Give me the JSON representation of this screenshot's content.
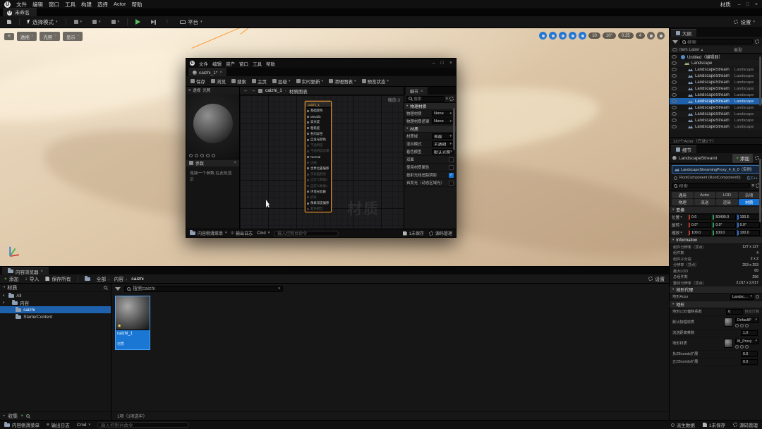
{
  "colors": {
    "selection_blue": "#1673d6",
    "accent_orange": "#e8963c",
    "play_green": "#57c05a"
  },
  "glyphs": {
    "minimize": "–",
    "maximize": "□",
    "close": "×"
  },
  "titlebar": {
    "menus": [
      "文件",
      "编辑",
      "窗口",
      "工具",
      "构建",
      "选择",
      "Actor",
      "帮助"
    ],
    "window_label": "材质"
  },
  "project_tab": {
    "label": "未命名"
  },
  "main_toolbar": {
    "mode_label": "选择模式",
    "platform_label": "平台",
    "settings_label": "设置"
  },
  "viewport": {
    "nav": {
      "perspective": "透视",
      "lit": "光照",
      "show": "显示"
    },
    "icons_left": [
      {
        "active": true
      },
      {
        "active": true
      },
      {
        "active": true
      },
      {
        "active": true
      },
      {
        "active": true
      }
    ],
    "badges": [
      "10",
      "10°",
      "0.25",
      "4"
    ],
    "icons_right": [
      {
        "active": false
      },
      {
        "active": false
      }
    ]
  },
  "material_editor": {
    "menus": [
      "文件",
      "编辑",
      "资产",
      "窗口",
      "工具",
      "帮助"
    ],
    "tab_label": "caizhi_1*",
    "toolbar": [
      {
        "label": "保存"
      },
      {
        "label": "浏览"
      },
      {
        "label": "搜索"
      },
      {
        "label": "主页"
      },
      {
        "label": "层级",
        "arrow": true
      },
      {
        "label": "实时更新",
        "arrow": true
      },
      {
        "label": "清理图表",
        "arrow": true
      },
      {
        "label": "预览状态",
        "arrow": true
      }
    ],
    "preview_nav": {
      "perspective": "透视",
      "lit": "光照"
    },
    "params": {
      "title": "参数",
      "empty_text": "连接一个参数,在此处显示"
    },
    "graph": {
      "asset": "caizhi_1",
      "page": "材质图表",
      "zoom": "缩放-3",
      "watermark": "材质"
    },
    "node": {
      "title": "caizhi_1",
      "pins": [
        {
          "label": "基础颜色"
        },
        {
          "label": "Metallic"
        },
        {
          "label": "高光度"
        },
        {
          "label": "粗糙度"
        },
        {
          "label": "各向异性"
        },
        {
          "label": "自发光颜色"
        },
        {
          "label": "不透明度",
          "dim": true
        },
        {
          "label": "不透明度遮罩",
          "dim": true
        },
        {
          "label": "Normal"
        },
        {
          "label": "切线",
          "dim": true
        },
        {
          "label": "世界位置偏移"
        },
        {
          "label": "次表面颜色",
          "dim": true
        },
        {
          "label": "自定义数据0",
          "dim": true
        },
        {
          "label": "自定义数据1",
          "dim": true
        },
        {
          "label": "环境光遮蔽"
        },
        {
          "label": "折射",
          "dim": true
        },
        {
          "label": "像素深度偏移"
        },
        {
          "label": "着色模型",
          "dim": true
        }
      ]
    },
    "details": {
      "tab": "细节",
      "search_placeholder": "搜索",
      "section_phys_title": "物理材质",
      "phys_rows": [
        {
          "label": "物理材质",
          "value": "None"
        },
        {
          "label": "物理材质遮罩",
          "value": "None"
        }
      ],
      "section_mat_title": "材质",
      "mat_rows": [
        {
          "label": "材质域",
          "value": "表面"
        },
        {
          "label": "混合模式",
          "value": "不透明"
        },
        {
          "label": "着色模型",
          "value": "默认光照"
        },
        {
          "label": "双面",
          "is_checkbox": true,
          "checked": false
        },
        {
          "label": "使用材质属性",
          "is_checkbox": true,
          "checked": false
        },
        {
          "label": "投射光线追踪阴影",
          "is_checkbox": true,
          "checked": true
        },
        {
          "label": "自发光（动态区域光）",
          "is_checkbox": true,
          "checked": false
        }
      ]
    },
    "statusbar": {
      "content_drawer": "内容侧滑菜单",
      "output_log": "输出日志",
      "cmd": "Cmd",
      "console_placeholder": "输入控制台命令",
      "unsaved": "1未保存",
      "source_control": "源码管理"
    }
  },
  "outliner": {
    "tab": "大纲",
    "search_placeholder": "搜索",
    "header": {
      "item_label": "Item Label",
      "type_label": "类型"
    },
    "rows": [
      {
        "label": "Untitled（编辑器）",
        "type": "",
        "world": true
      },
      {
        "label": "Landscape",
        "type": "",
        "parent": true,
        "d1": true
      },
      {
        "label": "LandscapeStream",
        "type": "Landscape",
        "d2": true
      },
      {
        "label": "LandscapeStream",
        "type": "Landscape",
        "d2": true
      },
      {
        "label": "LandscapeStream",
        "type": "Landscape",
        "d2": true
      },
      {
        "label": "LandscapeStream",
        "type": "Landscape",
        "d2": true
      },
      {
        "label": "LandscapeStream",
        "type": "Landscape",
        "d2": true
      },
      {
        "label": "LandscapeStream",
        "type": "Landscape",
        "d2": true,
        "selected": true
      },
      {
        "label": "LandscapeStream",
        "type": "Landscape",
        "d2": true
      },
      {
        "label": "LandscapeStream",
        "type": "Landscape",
        "d2": true
      },
      {
        "label": "LandscapeStream",
        "type": "Landscape",
        "d2": true
      },
      {
        "label": "LandscapeStream",
        "type": "Landscape",
        "d2": true
      }
    ],
    "footer": "137个Actor（已选1个）"
  },
  "details_panel": {
    "tab": "细节",
    "component_name": "LandscapeStreami",
    "add_label": "添加",
    "instance_label": "LandscapeStreamingProxy_4_6_0（实例）",
    "root_label": "RootComponent (RootComponent0)",
    "cpp_label": "在C++",
    "search_placeholder": "搜索",
    "chips": [
      {
        "label": "通用"
      },
      {
        "label": "Actor"
      },
      {
        "label": "LOD"
      },
      {
        "label": "杂项"
      },
      {
        "label": "物理"
      },
      {
        "label": "流送"
      },
      {
        "label": "渲染"
      },
      {
        "label": "材质",
        "active": true
      }
    ],
    "transform": {
      "title": "变换",
      "rows": [
        {
          "label": "位置",
          "x": "0.0",
          "y": "50400.0",
          "z": "100.0"
        },
        {
          "label": "旋转",
          "x": "0.0°",
          "y": "0.0°",
          "z": "0.0°"
        },
        {
          "label": "缩放",
          "x": "100.0",
          "y": "100.0",
          "z": "100.0"
        }
      ]
    },
    "information": {
      "title": "Information",
      "rows": [
        {
          "label": "组件分辨率（顶点）",
          "value": "127 x 127"
        },
        {
          "label": "组件数",
          "value": "4"
        },
        {
          "label": "组件子分段",
          "value": "2 x 2"
        },
        {
          "label": "分辨率（顶点）",
          "value": "253 x 253"
        },
        {
          "label": "最大LOD",
          "value": "65"
        },
        {
          "label": "总组件数",
          "value": "256"
        },
        {
          "label": "整体分辨率（顶点）",
          "value": "2,017 x 2,017"
        }
      ]
    },
    "proxy": {
      "title": "地形代理",
      "row_label": "地形Actor",
      "row_value": "Landsc…"
    },
    "landscape": {
      "title": "地形",
      "rows_a": [
        {
          "label": "地形LOD偏移系数",
          "value": "0",
          "note": "自动计算"
        }
      ],
      "phys_label": "默认物理材质",
      "phys_value": "DefaultP",
      "rows_b": [
        {
          "label": "流送距离乘数",
          "value": "1.0",
          "note": ""
        }
      ],
      "mat_label": "地形材质",
      "mat_value": "M_Proxy",
      "rows_c": [
        {
          "label": "负ZBounds扩展",
          "value": "0.0",
          "note": ""
        },
        {
          "label": "正ZBounds扩展",
          "value": "0.0",
          "note": ""
        }
      ]
    }
  },
  "content_browser": {
    "tab": "内容浏览器",
    "add_label": "添加",
    "import_label": "导入",
    "save_all_label": "保存所有",
    "breadcrumb": [
      "全部",
      "内容",
      "caizhi"
    ],
    "settings_label": "设置",
    "favorites_label": "材质",
    "tree": [
      {
        "label": "All",
        "expanded": true
      },
      {
        "label": "内容",
        "expanded": true,
        "d1": true
      },
      {
        "label": "caizhi",
        "d2": true,
        "selected": true
      },
      {
        "label": "StarterContent",
        "d2": true
      }
    ],
    "collections_label": "收集",
    "search_value": "搜索caizhi",
    "asset": {
      "name": "caizhi_1",
      "type": "材质"
    },
    "status": "1项（1项选中）"
  },
  "status_bar": {
    "content_drawer": "内容侧滑菜单",
    "output_log": "输出日志",
    "cmd": "Cmd",
    "console_placeholder": "输入控制台命令",
    "derived_data": "派生数据",
    "unsaved": "1未保存",
    "source_control": "源码管理"
  }
}
